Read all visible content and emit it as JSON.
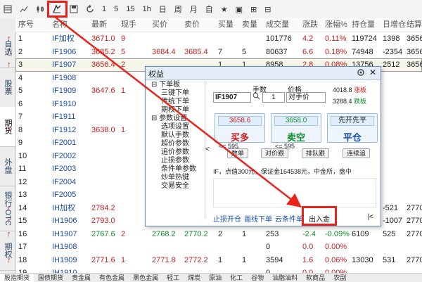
{
  "toolbar": {
    "buttons": [
      "1",
      "5",
      "15",
      "1h",
      "日",
      "周",
      "月",
      "自",
      "★",
      "▣",
      "⊞",
      "⊟"
    ],
    "active_hint": "交易"
  },
  "left_tabs": [
    "自选",
    "股票",
    "期货",
    "外盘",
    "银行·OTC",
    "期权"
  ],
  "columns": [
    "序号",
    "名称",
    "最新",
    "现手",
    "买价",
    "卖价",
    "买量",
    "卖量",
    "成交量",
    "涨跌",
    "涨幅%",
    "持仓量",
    "日增仓",
    "结算"
  ],
  "rows": [
    {
      "n": "1",
      "name": "IF加权",
      "last": "3671.0",
      "cur": "9",
      "bid": "",
      "ask": "",
      "bq": "",
      "aq": "",
      "vol": "101776",
      "chg": "4.2",
      "pct": "0.11%",
      "oi": "119724",
      "doi": "1398",
      "stl": "3656",
      "dir": "up"
    },
    {
      "n": "2",
      "name": "IF1906",
      "last": "3685.2",
      "cur": "5",
      "bid": "3684.4",
      "ask": "3685.4",
      "bq": "7",
      "aq": "5",
      "vol": "80637",
      "chg": "6.6",
      "pct": "0.18%",
      "oi": "74948",
      "doi": "-2354",
      "stl": "3656",
      "dir": "up"
    },
    {
      "n": "3",
      "name": "IF1907",
      "last": "3656.4",
      "cur": "2",
      "bid": "",
      "ask": "",
      "bq": "1",
      "aq": "1",
      "vol": "8958",
      "chg": "2.8",
      "pct": "0.08%",
      "oi": "13756",
      "doi": "2512",
      "stl": "3656",
      "dir": "up"
    },
    {
      "n": "4",
      "name": "IF1908",
      "last": "",
      "cur": "",
      "bid": "",
      "ask": "",
      "bq": "",
      "aq": "",
      "vol": "",
      "chg": "",
      "pct": "",
      "oi": "",
      "doi": "",
      "stl": "",
      "dir": ""
    },
    {
      "n": "5",
      "name": "IF1909",
      "last": "3647.6",
      "cur": "1",
      "bid": "",
      "ask": "",
      "bq": "",
      "aq": "",
      "vol": "",
      "chg": "",
      "pct": "",
      "oi": "",
      "doi": "",
      "stl": "",
      "dir": "up"
    },
    {
      "n": "6",
      "name": "IF1910",
      "last": "",
      "cur": "",
      "bid": "",
      "ask": "",
      "bq": "",
      "aq": "",
      "vol": "",
      "chg": "",
      "pct": "",
      "oi": "",
      "doi": "",
      "stl": "",
      "dir": ""
    },
    {
      "n": "7",
      "name": "IF1911",
      "last": "",
      "cur": "",
      "bid": "",
      "ask": "",
      "bq": "",
      "aq": "",
      "vol": "",
      "chg": "",
      "pct": "",
      "oi": "",
      "doi": "",
      "stl": "",
      "dir": ""
    },
    {
      "n": "8",
      "name": "IF1912",
      "last": "3638.0",
      "cur": "1",
      "bid": "",
      "ask": "",
      "bq": "",
      "aq": "",
      "vol": "",
      "chg": "",
      "pct": "",
      "oi": "",
      "doi": "",
      "stl": "",
      "dir": "up"
    },
    {
      "n": "9",
      "name": "IF2001",
      "last": "",
      "cur": "",
      "bid": "",
      "ask": "",
      "bq": "",
      "aq": "",
      "vol": "",
      "chg": "",
      "pct": "",
      "oi": "",
      "doi": "",
      "stl": "",
      "dir": ""
    },
    {
      "n": "10",
      "name": "IF2002",
      "last": "",
      "cur": "",
      "bid": "",
      "ask": "",
      "bq": "",
      "aq": "",
      "vol": "",
      "chg": "",
      "pct": "",
      "oi": "",
      "doi": "",
      "stl": "",
      "dir": ""
    },
    {
      "n": "11",
      "name": "IF2003",
      "last": "",
      "cur": "",
      "bid": "",
      "ask": "",
      "bq": "",
      "aq": "",
      "vol": "",
      "chg": "",
      "pct": "",
      "oi": "",
      "doi": "",
      "stl": "",
      "dir": ""
    },
    {
      "n": "12",
      "name": "IF2004",
      "last": "",
      "cur": "",
      "bid": "",
      "ask": "",
      "bq": "",
      "aq": "",
      "vol": "",
      "chg": "",
      "pct": "",
      "oi": "",
      "doi": "",
      "stl": "",
      "dir": ""
    },
    {
      "n": "13",
      "name": "IF2005",
      "last": "",
      "cur": "",
      "bid": "",
      "ask": "",
      "bq": "",
      "aq": "",
      "vol": "",
      "chg": "",
      "pct": "",
      "oi": "",
      "doi": "",
      "stl": "",
      "dir": ""
    },
    {
      "n": "14",
      "name": "IH加权",
      "last": "2784.2",
      "cur": "",
      "bid": "",
      "ask": "",
      "bq": "",
      "aq": "",
      "vol": "",
      "chg": "",
      "pct": "",
      "oi": "",
      "doi": "-521",
      "stl": "2770",
      "dir": "up"
    },
    {
      "n": "15",
      "name": "IH1906",
      "last": "2793.0",
      "cur": "",
      "bid": "",
      "ask": "",
      "bq": "",
      "aq": "",
      "vol": "",
      "chg": "",
      "pct": "",
      "oi": "",
      "doi": "-1007",
      "stl": "2770",
      "dir": "up"
    },
    {
      "n": "16",
      "name": "IH1907",
      "last": "2767.6",
      "cur": "2",
      "bid": "2768.2",
      "ask": "2770.2",
      "bq": "2",
      "aq": "1",
      "vol": "253",
      "chg": "-2.4",
      "pct": "-0.09%",
      "oi": "6109",
      "doi": "525",
      "stl": "2770",
      "dir": "up"
    },
    {
      "n": "17",
      "name": "IH1908",
      "last": "",
      "cur": "",
      "bid": "",
      "ask": "",
      "bq": "",
      "aq": "",
      "vol": "0",
      "chg": "0.0",
      "pct": "0.00%",
      "oi": "",
      "doi": "",
      "stl": "",
      "dir": ""
    },
    {
      "n": "18",
      "name": "IH1909",
      "last": "2771.6",
      "cur": "1",
      "bid": "2771.8",
      "ask": "2772.2",
      "bq": "1",
      "aq": "1",
      "vol": "3594",
      "chg": "1.6",
      "pct": "0.06%",
      "oi": "13030",
      "doi": "531",
      "stl": "2770",
      "dir": "up"
    },
    {
      "n": "19",
      "name": "IH1910",
      "last": "",
      "cur": "",
      "bid": "",
      "ask": "",
      "bq": "",
      "aq": "",
      "vol": "0",
      "chg": "0.0",
      "pct": "0.00%",
      "oi": "",
      "doi": "",
      "stl": "",
      "dir": ""
    }
  ],
  "dialog": {
    "title": "权益",
    "tree": [
      "下单板",
      "三键下单",
      "传统下单",
      "期权下单",
      "参数设置",
      "选项设置",
      "默认手数",
      "超价参数",
      "追价参数",
      "止损参数",
      "条件单参数",
      "炒单热键",
      "交易安全"
    ],
    "code": "IF1907",
    "qty_label": "手数",
    "qty": "1",
    "price_label": "价格",
    "price_value": "对手价",
    "limit_up": "4018.8",
    "limit_up_label": "涨板",
    "limit_down": "3288.4",
    "limit_down_label": "跌板",
    "buy_price": "3658.6",
    "buy_label": "买多",
    "sell_price": "3658.0",
    "sell_label": "卖空",
    "close_top": "先开先平",
    "close_label": "平仓",
    "buy_avail": "<= 595",
    "sell_avail": "<= 595",
    "small_buttons": [
      "数单",
      "对价跟",
      "排队跟",
      "连续追"
    ],
    "info": "IF，点值300元，保证金164538元，中金所，盘中",
    "links": [
      "止损开仓",
      "画线下单",
      "云条件单",
      "出入金"
    ],
    "collapse": "<",
    "expand": "|<"
  },
  "bottom_tabs": [
    "股指期货",
    "国债期货",
    "贵金属",
    "有色金属",
    "黑色金属",
    "轻工",
    "煤炭",
    "原油",
    "化工",
    "谷物",
    "油脂油料",
    "软商品",
    "农副"
  ]
}
